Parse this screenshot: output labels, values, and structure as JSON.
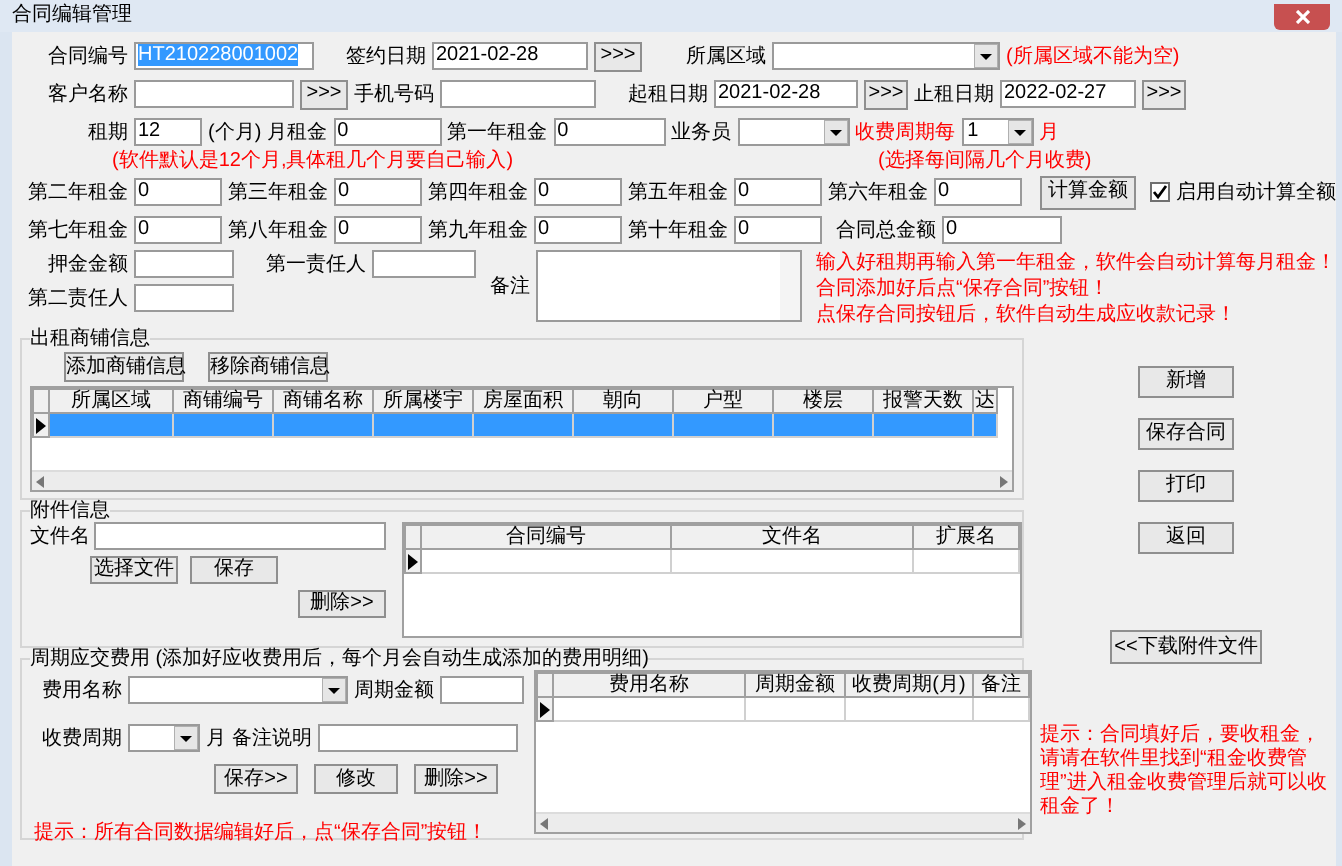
{
  "window": {
    "title": "合同编辑管理"
  },
  "contract": {
    "contract_no": {
      "label": "合同编号",
      "value": "HT210228001002",
      "selected": true
    },
    "sign_date": {
      "label": "签约日期",
      "value": "2021-02-28",
      "button": ">>>"
    },
    "region": {
      "label": "所属区域",
      "hint": "(所属区域不能为空)"
    },
    "customer": {
      "label": "客户名称",
      "button": ">>>"
    },
    "phone": {
      "label": "手机号码"
    },
    "start_date": {
      "label": "起租日期",
      "value": "2021-02-28",
      "button": ">>>"
    },
    "end_date": {
      "label": "止租日期",
      "value": "2022-02-27",
      "button": ">>>"
    },
    "term": {
      "label": "租期",
      "value": "12",
      "unit": "(个月)",
      "hint": "(软件默认是12个月,具体租几个月要自己输入)"
    },
    "monthly_rent": {
      "label": "月租金",
      "value": "0"
    },
    "salesperson": {
      "label": "业务员"
    },
    "billing_cycle": {
      "label": "收费周期每",
      "value": "1",
      "unit": "月",
      "hint": "(选择每间隔几个月收费)"
    },
    "yearly_rents": [
      {
        "label": "第一年租金",
        "value": "0"
      },
      {
        "label": "第二年租金",
        "value": "0"
      },
      {
        "label": "第三年租金",
        "value": "0"
      },
      {
        "label": "第四年租金",
        "value": "0"
      },
      {
        "label": "第五年租金",
        "value": "0"
      },
      {
        "label": "第六年租金",
        "value": "0"
      },
      {
        "label": "第七年租金",
        "value": "0"
      },
      {
        "label": "第八年租金",
        "value": "0"
      },
      {
        "label": "第九年租金",
        "value": "0"
      },
      {
        "label": "第十年租金",
        "value": "0"
      }
    ],
    "total": {
      "label": "合同总金额",
      "value": "0"
    },
    "calc_button": "计算金额",
    "auto_calc": {
      "label": "启用自动计算全额",
      "checked": true
    },
    "deposit": {
      "label": "押金金额"
    },
    "person1": {
      "label": "第一责任人"
    },
    "person2": {
      "label": "第二责任人"
    },
    "remark": {
      "label": "备注"
    },
    "notes": [
      "输入好租期再输入第一年租金，软件会自动计算每月租金！",
      "合同添加好后点“保存合同”按钮！",
      "点保存合同按钮后，软件自动生成应收款记录！"
    ]
  },
  "shops": {
    "title": "出租商铺信息",
    "buttons": [
      "添加商铺信息",
      "移除商铺信息"
    ],
    "columns": [
      "所属区域",
      "商铺编号",
      "商铺名称",
      "所属楼宇",
      "房屋面积",
      "朝向",
      "户型",
      "楼层",
      "报警天数",
      "达"
    ],
    "rows": [
      {
        "selected": true,
        "current": true
      }
    ]
  },
  "attachments": {
    "title": "附件信息",
    "file_label": "文件名",
    "buttons": [
      "选择文件",
      "保存"
    ],
    "delete_button": "删除>>",
    "columns": [
      "合同编号",
      "文件名",
      "扩展名"
    ],
    "rows": [
      {
        "selected": false,
        "current": true
      }
    ]
  },
  "fees": {
    "title": "周期应交费用 (添加好应收费用后，每个月会自动生成添加的费用明细)",
    "name_label": "费用名称",
    "amount_label": "周期金额",
    "cycle_label": "收费周期",
    "cycle_unit": "月",
    "remark_label": "备注说明",
    "buttons": [
      "保存>>",
      "修改",
      "删除>>"
    ],
    "columns": [
      "费用名称",
      "周期金额",
      "收费周期(月)",
      "备注"
    ],
    "rows": [
      {
        "selected": false,
        "current": true
      }
    ],
    "tip": "提示：所有合同数据编辑好后，点“保存合同”按钮！"
  },
  "side_buttons": [
    "新增",
    "保存合同",
    "打印",
    "返回"
  ],
  "download_button": "<<下载附件文件",
  "side_tip": "提示：合同填好后，要收租金，请请在软件里找到“租金收费管理”进入租金收费管理后就可以收租金了！"
}
